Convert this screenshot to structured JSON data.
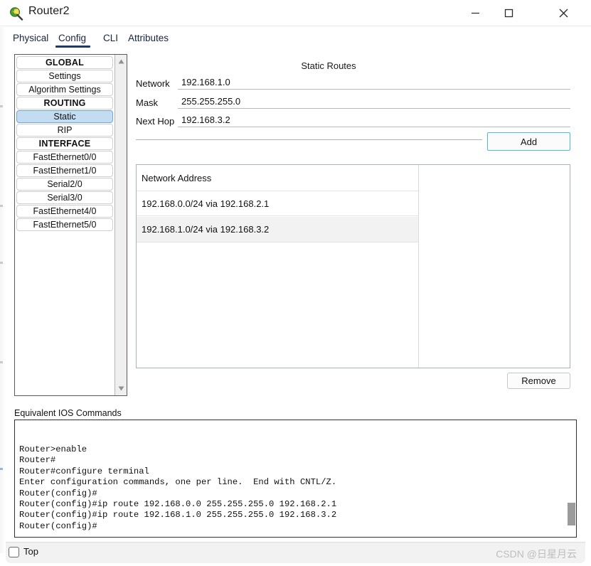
{
  "window": {
    "title": "Router2",
    "icon": "router-icon",
    "controls": {
      "minimize": "—",
      "maximize": "☐",
      "close": "✕"
    }
  },
  "tabs": [
    {
      "label": "Physical",
      "active": false
    },
    {
      "label": "Config",
      "active": true
    },
    {
      "label": "CLI",
      "active": false
    },
    {
      "label": "Attributes",
      "active": false
    }
  ],
  "sidebar": {
    "items": [
      {
        "label": "GLOBAL",
        "type": "header",
        "selected": false
      },
      {
        "label": "Settings",
        "type": "item",
        "selected": false
      },
      {
        "label": "Algorithm Settings",
        "type": "item",
        "selected": false
      },
      {
        "label": "ROUTING",
        "type": "header",
        "selected": false
      },
      {
        "label": "Static",
        "type": "item",
        "selected": true
      },
      {
        "label": "RIP",
        "type": "item",
        "selected": false
      },
      {
        "label": "INTERFACE",
        "type": "header",
        "selected": false
      },
      {
        "label": "FastEthernet0/0",
        "type": "item",
        "selected": false
      },
      {
        "label": "FastEthernet1/0",
        "type": "item",
        "selected": false
      },
      {
        "label": "Serial2/0",
        "type": "item",
        "selected": false
      },
      {
        "label": "Serial3/0",
        "type": "item",
        "selected": false
      },
      {
        "label": "FastEthernet4/0",
        "type": "item",
        "selected": false
      },
      {
        "label": "FastEthernet5/0",
        "type": "item",
        "selected": false
      }
    ],
    "scroll_up": "▲",
    "scroll_down": "▼"
  },
  "static_routes": {
    "title": "Static Routes",
    "fields": {
      "network_label": "Network",
      "network_value": "192.168.1.0",
      "mask_label": "Mask",
      "mask_value": "255.255.255.0",
      "next_hop_label": "Next Hop",
      "next_hop_value": "192.168.3.2"
    },
    "add_label": "Add",
    "remove_label": "Remove",
    "table": {
      "header": "Network Address",
      "rows": [
        "192.168.0.0/24 via 192.168.2.1",
        "192.168.1.0/24 via 192.168.3.2"
      ]
    }
  },
  "ios": {
    "label": "Equivalent IOS Commands",
    "text": "Router>enable\nRouter#\nRouter#configure terminal\nEnter configuration commands, one per line.  End with CNTL/Z.\nRouter(config)#\nRouter(config)#ip route 192.168.0.0 255.255.255.0 192.168.2.1\nRouter(config)#ip route 192.168.1.0 255.255.255.0 192.168.3.2\nRouter(config)#"
  },
  "footer": {
    "top_checkbox_label": "Top",
    "top_checked": false,
    "watermark": "CSDN @日星月云"
  },
  "colors": {
    "accent_focus": "#45bdf2",
    "tab_active": "#1f3864",
    "selection": "#c3dcf2",
    "row_alt": "#f2f2f2"
  }
}
